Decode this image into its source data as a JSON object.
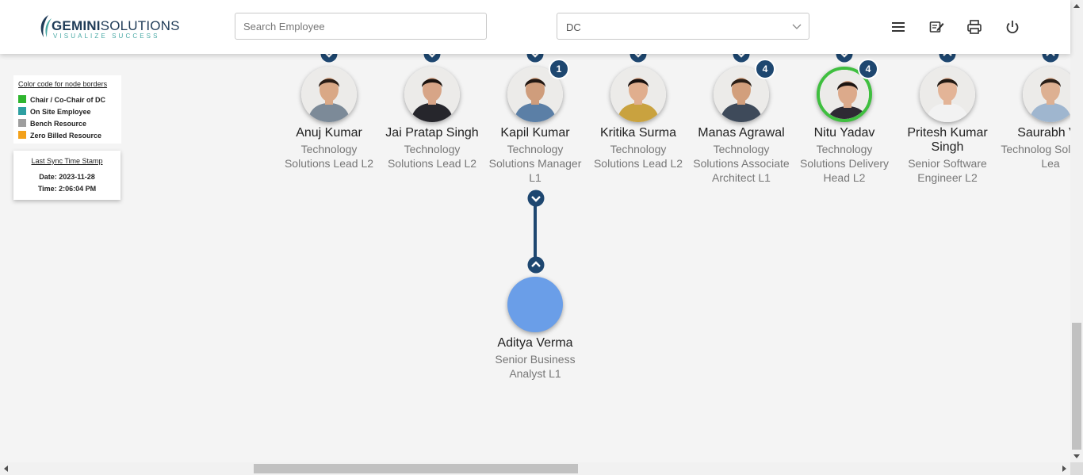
{
  "header": {
    "logo_name_bold": "GEMINI",
    "logo_name_light": "SOLUTIONS",
    "logo_tagline": "VISUALIZE SUCCESS",
    "search_placeholder": "Search Employee",
    "department_select": "DC",
    "icons": [
      "menu-icon",
      "notes-icon",
      "print-icon",
      "power-icon"
    ]
  },
  "legend": {
    "title": "Color code for node borders",
    "items": [
      {
        "label": "Chair / Co-Chair of DC",
        "color": "#2fb52f"
      },
      {
        "label": "On Site Employee",
        "color": "#2e9fa1"
      },
      {
        "label": "Bench Resource",
        "color": "#9e9e9e"
      },
      {
        "label": "Zero Billed Resource",
        "color": "#f3a11a"
      }
    ]
  },
  "sync": {
    "title": "Last Sync Time Stamp",
    "date": "Date: 2023-11-28",
    "time": "Time: 2:06:04 PM"
  },
  "employees": [
    {
      "name": "Anuj Kumar",
      "title": "Technology Solutions Lead L2"
    },
    {
      "name": "Jai Pratap Singh",
      "title": "Technology Solutions Lead L2"
    },
    {
      "name": "Kapil Kumar",
      "title": "Technology Solutions Manager L1",
      "reports": "1"
    },
    {
      "name": "Kritika Surma",
      "title": "Technology Solutions Lead L2"
    },
    {
      "name": "Manas Agrawal",
      "title": "Technology Solutions Associate Architect L1",
      "reports": "4"
    },
    {
      "name": "Nitu Yadav",
      "title": "Technology Solutions Delivery Head L2",
      "reports": "4",
      "border_color": "#3fbf3f"
    },
    {
      "name": "Pritesh Kumar Singh",
      "title": "Senior Software Engineer L2"
    },
    {
      "name": "Saurabh Ve",
      "title": "Technolog Solutions Lea"
    }
  ],
  "child": {
    "name": "Aditya Verma",
    "title": "Senior Business Analyst L1",
    "avatar_color": "#6a9ee8"
  },
  "colors": {
    "node_toggle": "#1e4770",
    "ring": "#3fbf3f"
  }
}
